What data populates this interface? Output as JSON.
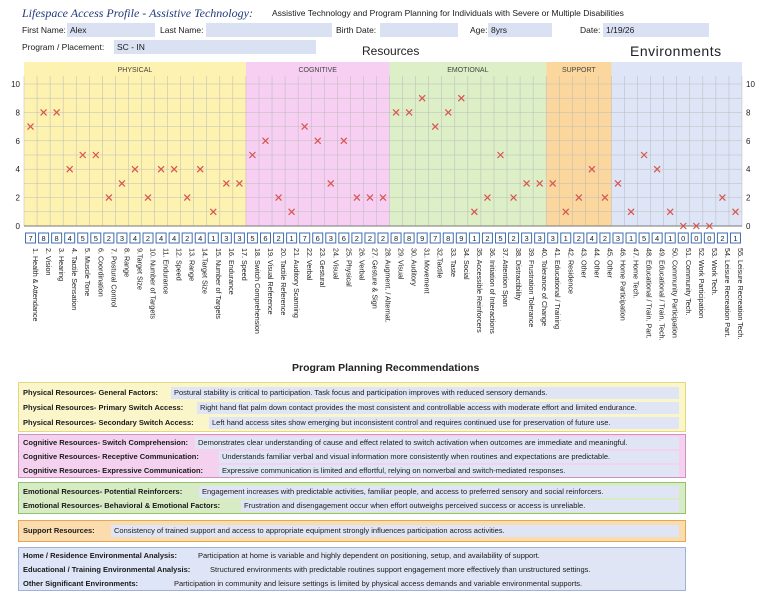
{
  "header": {
    "title": "Lifespace Access Profile - Assistive Technology:",
    "subtitle": "Assistive Technology and Program Planning for Individuals with Severe or Multiple Disabilities",
    "first_name_label": "First Name:",
    "first_name": "Alex",
    "last_name_label": "Last Name:",
    "last_name": "",
    "birth_date_label": "Birth Date:",
    "birth_date": "",
    "age_label": "Age:",
    "age": "8yrs",
    "date_label": "Date:",
    "date": "1/19/26",
    "program_label": "Program / Placement:",
    "program": "SC - IN",
    "resources_title": "Resources",
    "environments_title": "Environments"
  },
  "chart_data": {
    "type": "scatter",
    "ylim": [
      0,
      10
    ],
    "yticks": [
      0,
      2,
      4,
      6,
      8,
      10
    ],
    "grid": true,
    "groups": [
      {
        "name": "PHYSICAL",
        "start": 0,
        "end": 17,
        "color": "#fdf2b0"
      },
      {
        "name": "COGNITIVE",
        "start": 17,
        "end": 28,
        "color": "#f6cff2"
      },
      {
        "name": "EMOTIONAL",
        "start": 28,
        "end": 40,
        "color": "#dcefc6"
      },
      {
        "name": "SUPPORT",
        "start": 40,
        "end": 45,
        "color": "#fbd79e"
      },
      {
        "name": "",
        "start": 45,
        "end": 55,
        "color": "#dde5f6"
      }
    ],
    "categories": [
      "1. Health & Attendance",
      "2. Vision",
      "3. Hearing",
      "4. Tactile Sensation",
      "5. Muscle Tone",
      "6. Coordination",
      "7. Postural Control",
      "8. Range",
      "9.Target Size",
      "10. Number of Targets",
      "11. Endurance",
      "12. Speed",
      "13. Range",
      "14.Target Size",
      "15. Number of Targets",
      "16. Endurance",
      "17. Speed",
      "18. Switch Comprehension",
      "19. Visual Reference",
      "20. Tactile Reference",
      "21. Auditory Scanning",
      "22. Verbal",
      "23. Gestural",
      "24. Visual",
      "25. Physical",
      "26. Verbal",
      "27. Gesture & Sign",
      "28. Augment. / Alternat.",
      "29. Visual",
      "30. Auditory",
      "31. Movement",
      "32.Tactile",
      "33. Taste",
      "34. Social",
      "35. Accessible Reinforcers",
      "36. Initiation of Interactions",
      "37. Attention Span",
      "38. Distractibility",
      "39. Frustration Tolerance",
      "40. Tolerance of Change",
      "41. Educational / Training",
      "42. Residence",
      "43. Other",
      "44. Other",
      "45. Other",
      "46. Home Participation",
      "47. Home Tech.",
      "48. Educational / Train. Part.",
      "49. Educational / Train. Tech.",
      "50. Community Participation",
      "51. Community Tech.",
      "52. Work Participation",
      "53. Work Tech.",
      "54. Leisure Recreation Part.",
      "55. Leisure Recreation Tech."
    ],
    "values": [
      7,
      8,
      8,
      4,
      5,
      5,
      2,
      3,
      4,
      2,
      4,
      4,
      2,
      4,
      1,
      3,
      3,
      5,
      6,
      2,
      1,
      7,
      6,
      3,
      6,
      2,
      2,
      2,
      8,
      8,
      9,
      7,
      8,
      9,
      1,
      2,
      5,
      2,
      3,
      3,
      3,
      1,
      2,
      4,
      2,
      3,
      1,
      5,
      4,
      1,
      0,
      0,
      0,
      2,
      1
    ]
  },
  "program_planning": {
    "title": "Program Planning Recommendations",
    "physical": [
      {
        "label": "Physical Resources- General Factors:",
        "text": "Postural stability is critical to participation. Task focus and participation improves with reduced sensory demands."
      },
      {
        "label": "Physical Resources- Primary Switch Access:",
        "text": "Right hand flat palm down contact provides the most consistent and controllable access with moderate effort and limited endurance."
      },
      {
        "label": "Physical Resources- Secondary Switch Access:",
        "text": "Left hand access sites show emerging but inconsistent control and requires continued use for preservation of future use."
      }
    ],
    "cognitive": [
      {
        "label": "Cognitive Resources- Switch Comprehension:",
        "text": "Demonstrates clear understanding of cause and effect related to switch activation when outcomes are immediate and meaningful."
      },
      {
        "label": "Cognitive Resources- Receptive Communication:",
        "text": "Understands familiar verbal and visual information more consistently when routines and expectations are predictable."
      },
      {
        "label": "Cognitive Resources- Expressive Communication:",
        "text": "Expressive communication is limited and effortful, relying on nonverbal and switch-mediated responses."
      }
    ],
    "emotional": [
      {
        "label": "Emotional Resources- Potential Reinforcers:",
        "text": "Engagement increases with predictable activities, familiar people, and access to preferred sensory and social reinforcers."
      },
      {
        "label": "Emotional Resources- Behavioral & Emotional Factors:",
        "text": "Frustration and disengagement occur when effort outweighs perceived success or access is unreliable."
      }
    ],
    "support": [
      {
        "label": "Support Resources:",
        "text": "Consistency of trained support and access to appropriate equipment strongly influences participation across activities."
      }
    ],
    "environment": [
      {
        "label": "Home / Residence Environmental  Analysis:",
        "text": "Participation at home is variable and highly dependent on positioning, setup, and availability of support."
      },
      {
        "label": "Educational / Training Environmental Analysis:",
        "text": "Structured environments with predictable routines support engagement more effectively than unstructured settings."
      },
      {
        "label": "Other  Significant  Environments:",
        "text": "Participation in community and leisure settings is limited by physical access demands and variable environmental supports."
      }
    ]
  },
  "colors": {
    "marker": "#d9534f",
    "value_box": "#3e6fb0",
    "field_bg": "#d9e1f2",
    "title": "#1f3a7a"
  }
}
